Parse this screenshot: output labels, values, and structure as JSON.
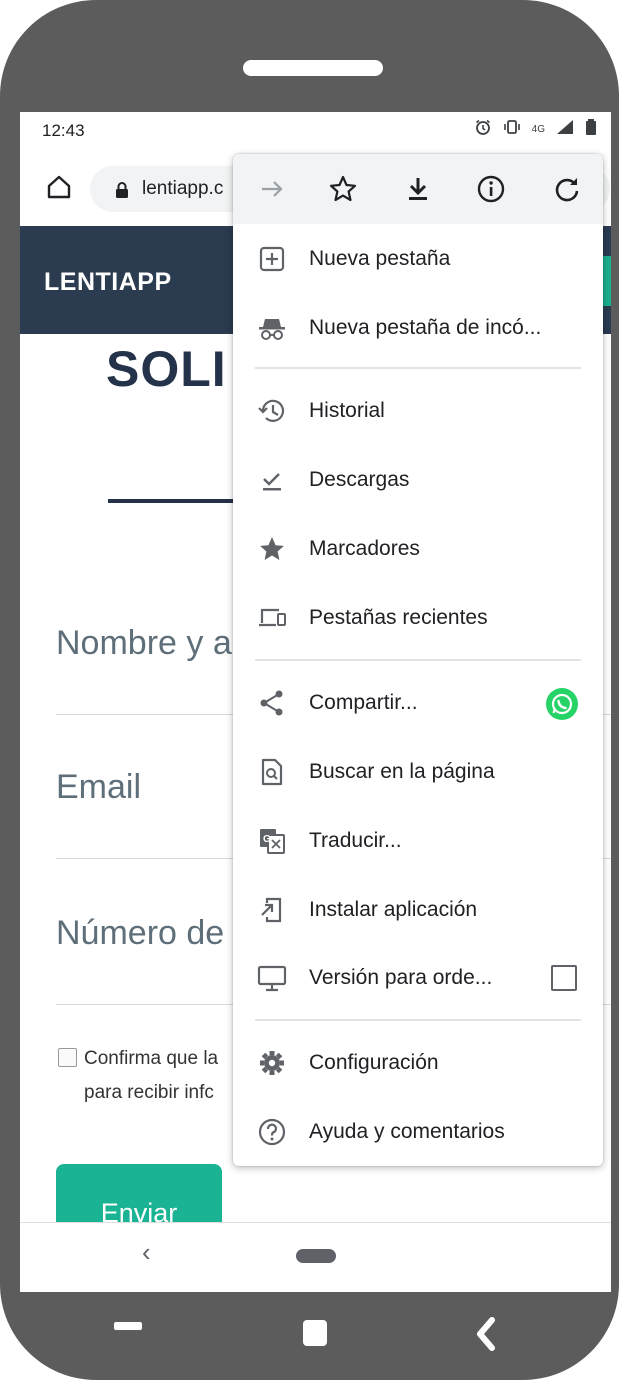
{
  "status_bar": {
    "time": "12:43",
    "network": "4G"
  },
  "browser": {
    "url": "lentiapp.c"
  },
  "page": {
    "logo": "LENTIAPP",
    "heading": "SOLI",
    "fields": [
      "Nombre y ap",
      "Email",
      "Número de t"
    ],
    "consent_line1": "Confirma que la",
    "consent_line2": "para recibir infc",
    "submit_label": "Enviar"
  },
  "menu": {
    "toolbar_icons": [
      "forward-icon",
      "bookmark-star-icon",
      "download-icon",
      "info-icon",
      "reload-icon"
    ],
    "items": [
      {
        "label": "Nueva pestaña",
        "icon": "new-tab-icon"
      },
      {
        "label": "Nueva pestaña de incó...",
        "icon": "incognito-icon"
      },
      {
        "label": "Historial",
        "icon": "history-icon"
      },
      {
        "label": "Descargas",
        "icon": "downloads-icon"
      },
      {
        "label": "Marcadores",
        "icon": "bookmarks-icon"
      },
      {
        "label": "Pestañas recientes",
        "icon": "recent-tabs-icon"
      },
      {
        "label": "Compartir...",
        "icon": "share-icon"
      },
      {
        "label": "Buscar en la página",
        "icon": "find-in-page-icon"
      },
      {
        "label": "Traducir...",
        "icon": "translate-icon"
      },
      {
        "label": "Instalar aplicación",
        "icon": "install-app-icon"
      },
      {
        "label": "Versión para orde...",
        "icon": "desktop-icon"
      },
      {
        "label": "Configuración",
        "icon": "settings-icon"
      },
      {
        "label": "Ayuda y comentarios",
        "icon": "help-icon"
      }
    ]
  },
  "colors": {
    "header": "#2b3b50",
    "accent": "#1ab394",
    "whatsapp": "#25d366",
    "frame": "#5c5c5c"
  }
}
